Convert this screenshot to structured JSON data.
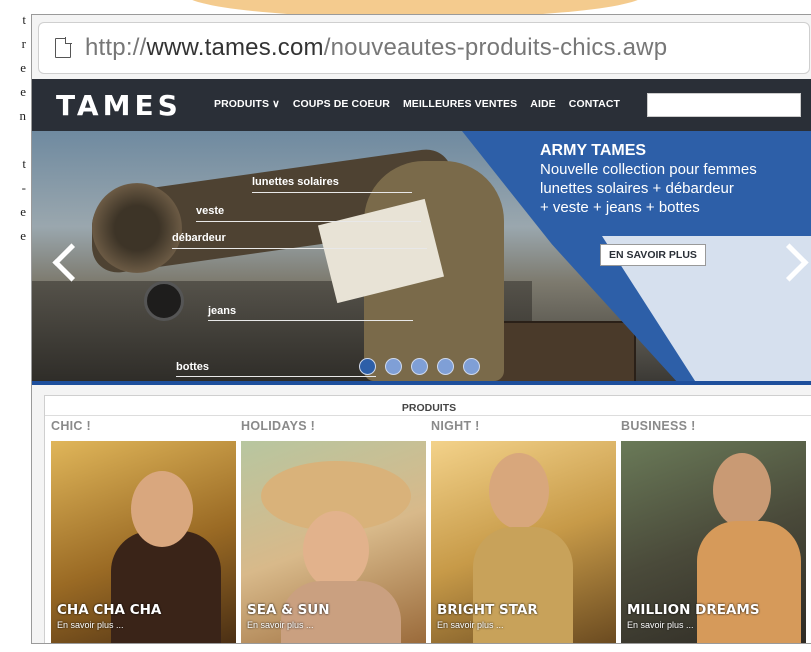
{
  "left_text_fragment": [
    "t",
    "r",
    "e",
    "e",
    "n",
    "t",
    "-",
    "e",
    "e"
  ],
  "browser": {
    "url_prefix": "http://",
    "url_domain": "www.tames.com",
    "url_path": "/nouveautes-produits-chics.awp"
  },
  "header": {
    "logo": "TAMES",
    "nav": [
      "PRODUITS ∨",
      "COUPS DE COEUR",
      "MEILLEURES VENTES",
      "AIDE",
      "CONTACT"
    ],
    "search_value": ""
  },
  "hero": {
    "title": "ARMY TAMES",
    "lines": [
      "Nouvelle collection pour femmes",
      "lunettes solaires + débardeur",
      "+ veste + jeans + bottes"
    ],
    "cta": "EN SAVOIR PLUS",
    "labels": [
      "lunettes solaires",
      "veste",
      "débardeur",
      "jeans",
      "bottes"
    ],
    "slide_count": 5,
    "active_slide": 1
  },
  "products": {
    "title": "PRODUITS",
    "categories": [
      {
        "heading": "CHIC !",
        "name": "CHA CHA CHA",
        "link": "En savoir plus ..."
      },
      {
        "heading": "HOLIDAYS !",
        "name": "SEA & SUN",
        "link": "En savoir plus ..."
      },
      {
        "heading": "NIGHT !",
        "name": "BRIGHT STAR",
        "link": "En savoir plus ..."
      },
      {
        "heading": "BUSINESS !",
        "name": "MILLION DREAMS",
        "link": "En savoir plus ..."
      }
    ]
  },
  "colors": {
    "header_bg": "#2a2f37",
    "accent_blue": "#2d5fa8"
  }
}
